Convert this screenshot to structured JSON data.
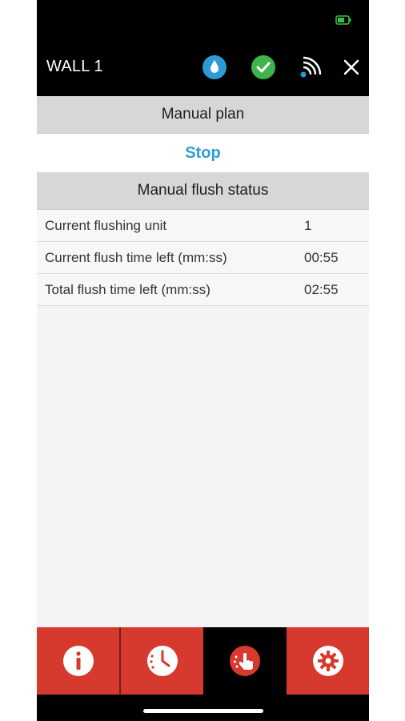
{
  "header": {
    "title": "WALL 1",
    "icons": [
      "water-drop-icon",
      "check-circle-icon",
      "signal-icon",
      "close-icon"
    ]
  },
  "manual_plan": {
    "heading": "Manual plan",
    "stop_label": "Stop"
  },
  "flush_status": {
    "heading": "Manual flush status",
    "rows": [
      {
        "label": "Current flushing unit",
        "value": "1"
      },
      {
        "label": "Current flush time left (mm:ss)",
        "value": "00:55"
      },
      {
        "label": "Total flush time left (mm:ss)",
        "value": "02:55"
      }
    ]
  },
  "tabbar": {
    "tabs": [
      {
        "icon": "info-icon",
        "active": false
      },
      {
        "icon": "clock-icon",
        "active": false
      },
      {
        "icon": "manual-touch-icon",
        "active": true
      },
      {
        "icon": "gear-icon",
        "active": false
      }
    ]
  },
  "colors": {
    "accent_red": "#d63a2e",
    "stop_blue": "#2f9fd2",
    "check_green": "#3fb44a",
    "drop_blue": "#2c9ad6"
  }
}
